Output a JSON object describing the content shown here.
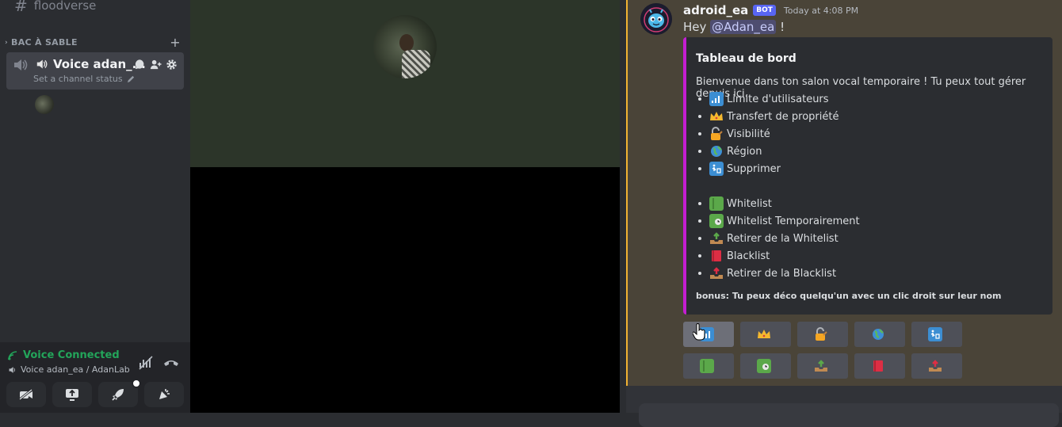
{
  "sidebar": {
    "top_channel": "floodverse",
    "category": "BAC À SABLE",
    "voice_channel": {
      "name": "Voice adan_...",
      "status_placeholder": "Set a channel status"
    },
    "voice_panel": {
      "title": "Voice Connected",
      "subtitle": "Voice adan_ea / AdanLab",
      "status_color": "#23a55a"
    }
  },
  "chat": {
    "message": {
      "author": "adroid_ea",
      "badge": "BOT",
      "timestamp": "Today at 4:08 PM",
      "greeting": "Hey",
      "mention": "@Adan_ea",
      "greeting_end": "!"
    },
    "embed": {
      "accent": "#c41ed1",
      "title": "Tableau de bord",
      "description": "Bienvenue dans ton salon vocal temporaire ! Tu peux tout gérer depuis ici.",
      "items": [
        {
          "icon": "signal-bars-icon",
          "label": "Limite d'utilisateurs"
        },
        {
          "icon": "crown-icon",
          "label": "Transfert de propriété"
        },
        {
          "icon": "lock-key-icon",
          "label": "Visibilité"
        },
        {
          "icon": "globe-icon",
          "label": "Région"
        },
        {
          "icon": "wastebasket-icon",
          "label": "Supprimer"
        }
      ],
      "items2": [
        {
          "icon": "green-book-icon",
          "label": "Whitelist"
        },
        {
          "icon": "green-book-clock-icon",
          "label": "Whitelist Temporairement"
        },
        {
          "icon": "outbox-tray-green-icon",
          "label": "Retirer de la Whitelist"
        },
        {
          "icon": "red-book-icon",
          "label": "Blacklist"
        },
        {
          "icon": "outbox-tray-red-icon",
          "label": "Retirer de la Blacklist"
        }
      ],
      "footer": "bonus: Tu peux déco quelqu'un avec un clic droit sur leur nom"
    },
    "buttons": [
      [
        "signal-bars-icon",
        "crown-icon",
        "lock-key-icon",
        "globe-icon",
        "wastebasket-icon"
      ],
      [
        "green-book-icon",
        "green-book-clock-icon",
        "outbox-tray-green-icon",
        "red-book-icon",
        "outbox-tray-red-icon"
      ]
    ]
  }
}
